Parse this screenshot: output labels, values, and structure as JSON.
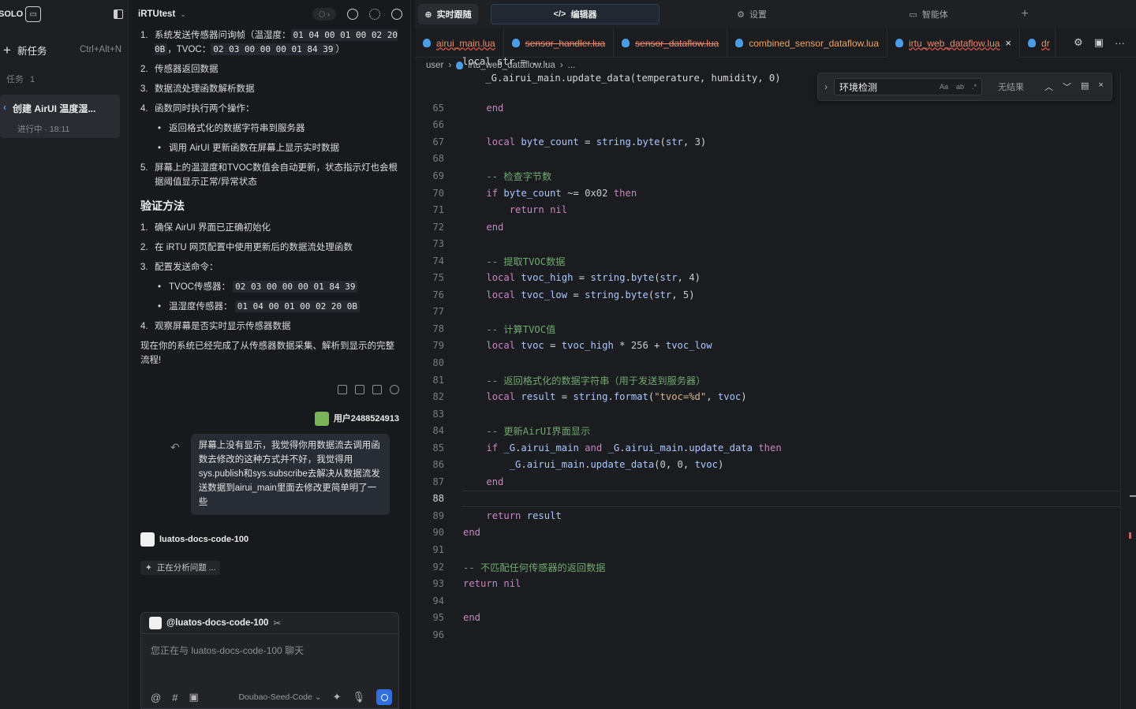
{
  "sidebar": {
    "logo": "SOLO",
    "new_task_label": "新任务",
    "new_task_shortcut": "Ctrl+Alt+N",
    "tasks_label": "任务",
    "tasks_count": "1",
    "task": {
      "title": "创建 AirUI 温度湿...",
      "status": "进行中 · 18:11"
    }
  },
  "chat": {
    "project": "iRTUtest",
    "list1": [
      {
        "n": "1.",
        "parts": [
          "系统发送传感器问询帧（温湿度：",
          "01 04 00 01 00 02 20 0B",
          "，TVOC：",
          "02 03 00 00 00 01 84 39",
          "）"
        ]
      },
      {
        "n": "2.",
        "text": "传感器返回数据"
      },
      {
        "n": "3.",
        "text": "数据流处理函数解析数据"
      },
      {
        "n": "4.",
        "text": "函数同时执行两个操作："
      },
      {
        "n": "5.",
        "text": "屏幕上的温湿度和TVOC数值会自动更新，状态指示灯也会根据阈值显示正常/异常状态"
      }
    ],
    "list1_sub": [
      "返回格式化的数据字符串到服务器",
      "调用 AirUI 更新函数在屏幕上显示实时数据"
    ],
    "verify_heading": "验证方法",
    "verify": [
      {
        "n": "1.",
        "text": "确保 AirUI 界面已正确初始化"
      },
      {
        "n": "2.",
        "text": "在 iRTU 网页配置中使用更新后的数据流处理函数"
      },
      {
        "n": "3.",
        "text": "配置发送命令："
      },
      {
        "n": "4.",
        "text": "观察屏幕是否实时显示传感器数据"
      }
    ],
    "verify_sub": [
      {
        "label": "TVOC传感器：",
        "code": "02 03 00 00 00 01 84 39"
      },
      {
        "label": "温湿度传感器：",
        "code": "01 04 00 01 00 02 20 0B"
      }
    ],
    "closing": "现在你的系统已经完成了从传感器数据采集、解析到显示的完整流程!",
    "user_name": "用户2488524913",
    "user_message": "屏幕上没有显示，我觉得你用数据流去调用函数去修改的这种方式并不好，我觉得用sys.publish和sys.subscribe去解决从数据流发送数据到airui_main里面去修改更简单明了一些",
    "agent_name": "luatos-docs-code-100",
    "analyzing": "正在分析问题 ...",
    "composer": {
      "mention": "@luatos-docs-code-100",
      "placeholder": "您正在与 luatos-docs-code-100 聊天",
      "model": "Doubao-Seed-Code"
    }
  },
  "editor": {
    "modes": {
      "realtime": "实时跟随",
      "editor": "编辑器",
      "settings": "设置",
      "agent": "智能体"
    },
    "tabs": [
      {
        "name": "airui_main.lua",
        "state": "err"
      },
      {
        "name": "sensor_handler.lua",
        "state": "strike"
      },
      {
        "name": "sensor_dataflow.lua",
        "state": "strike"
      },
      {
        "name": "combined_sensor_dataflow.lua",
        "state": "ok"
      },
      {
        "name": "irtu_web_dataflow.lua",
        "state": "err-active"
      },
      {
        "name": "dr",
        "state": "err"
      }
    ],
    "breadcrumb": [
      "user",
      "irtu_web_dataflow.lua",
      "..."
    ],
    "sticky": [
      "local str = ...",
      "    _G.airui_main.update_data(temperature, humidity, 0)"
    ],
    "find": {
      "query": "环境检测",
      "result": "无结果"
    },
    "current_line": 88,
    "lines": [
      {
        "n": 65,
        "t": "    end"
      },
      {
        "n": 66,
        "t": ""
      },
      {
        "n": 67,
        "t": "    local byte_count = string.byte(str, 3)"
      },
      {
        "n": 68,
        "t": ""
      },
      {
        "n": 69,
        "t": "    -- 检查字节数"
      },
      {
        "n": 70,
        "t": "    if byte_count ~= 0x02 then"
      },
      {
        "n": 71,
        "t": "        return nil"
      },
      {
        "n": 72,
        "t": "    end"
      },
      {
        "n": 73,
        "t": ""
      },
      {
        "n": 74,
        "t": "    -- 提取TVOC数据"
      },
      {
        "n": 75,
        "t": "    local tvoc_high = string.byte(str, 4)"
      },
      {
        "n": 76,
        "t": "    local tvoc_low = string.byte(str, 5)"
      },
      {
        "n": 77,
        "t": ""
      },
      {
        "n": 78,
        "t": "    -- 计算TVOC值"
      },
      {
        "n": 79,
        "t": "    local tvoc = tvoc_high * 256 + tvoc_low"
      },
      {
        "n": 80,
        "t": ""
      },
      {
        "n": 81,
        "t": "    -- 返回格式化的数据字符串（用于发送到服务器）"
      },
      {
        "n": 82,
        "t": "    local result = string.format(\"tvoc=%d\", tvoc)"
      },
      {
        "n": 83,
        "t": ""
      },
      {
        "n": 84,
        "t": "    -- 更新AirUI界面显示"
      },
      {
        "n": 85,
        "t": "    if _G.airui_main and _G.airui_main.update_data then"
      },
      {
        "n": 86,
        "t": "        _G.airui_main.update_data(0, 0, tvoc)"
      },
      {
        "n": 87,
        "t": "    end"
      },
      {
        "n": 88,
        "t": ""
      },
      {
        "n": 89,
        "t": "    return result"
      },
      {
        "n": 90,
        "t": "end"
      },
      {
        "n": 91,
        "t": ""
      },
      {
        "n": 92,
        "t": "-- 不匹配任何传感器的返回数据"
      },
      {
        "n": 93,
        "t": "return nil"
      },
      {
        "n": 94,
        "t": ""
      },
      {
        "n": 95,
        "t": "end"
      },
      {
        "n": 96,
        "t": ""
      }
    ]
  }
}
